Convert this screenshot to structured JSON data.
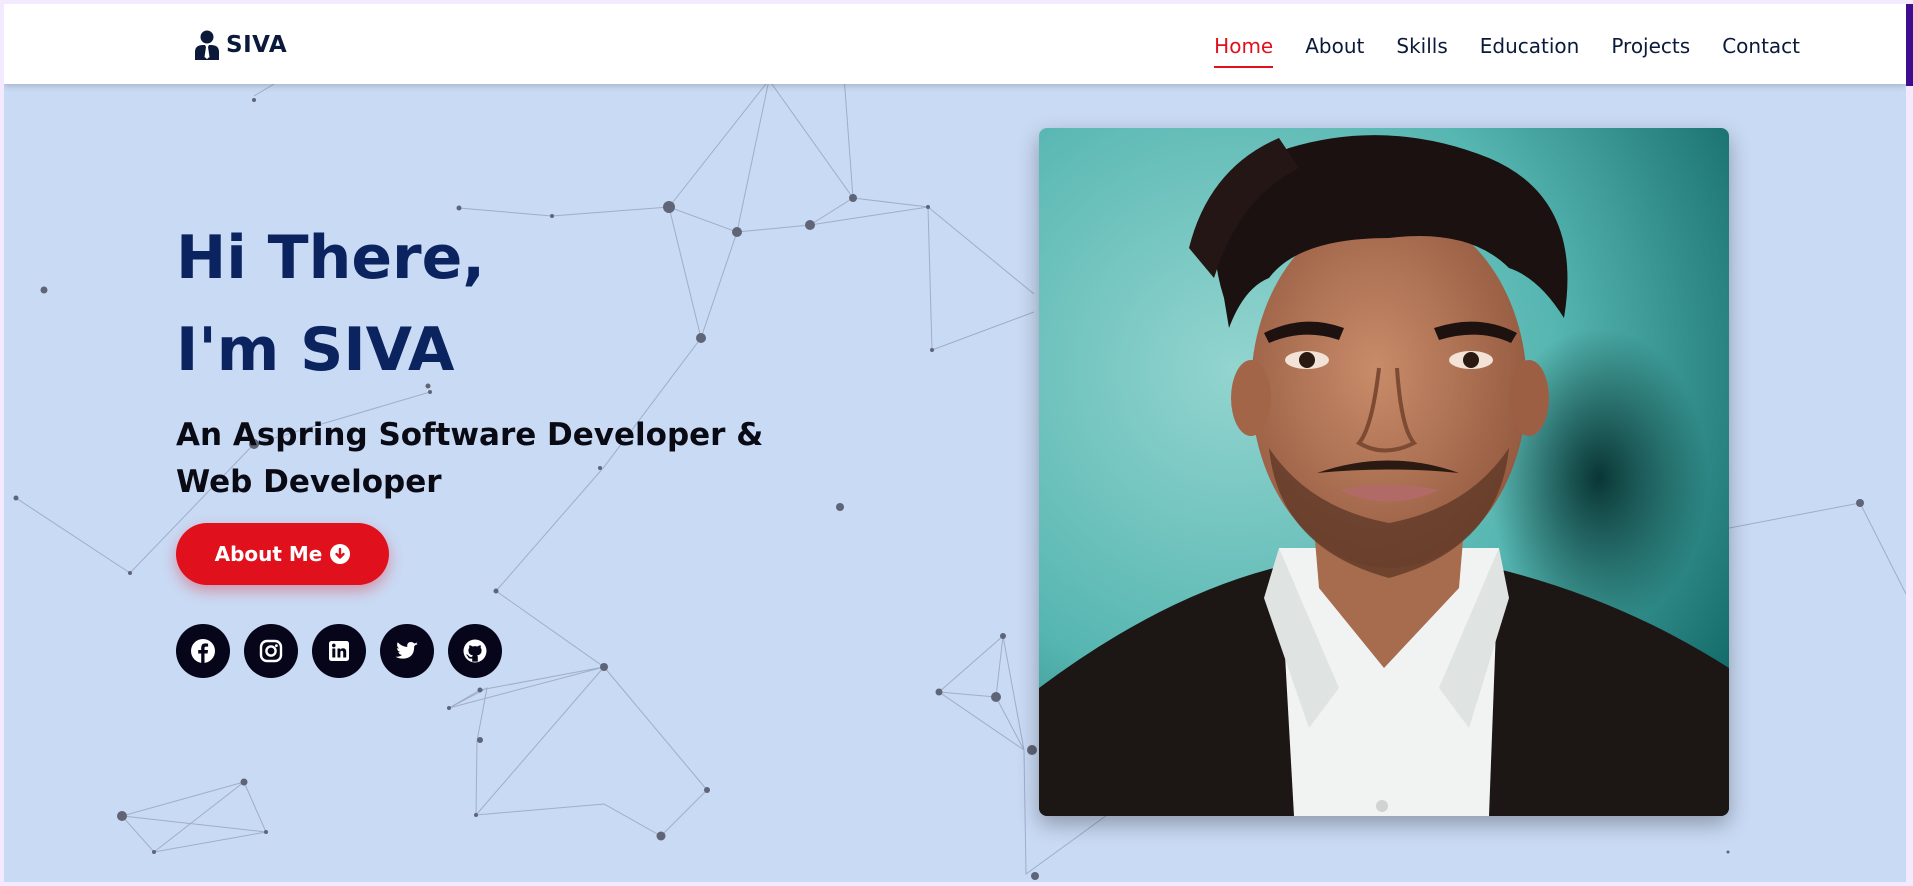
{
  "brand": {
    "name": "SIVA",
    "icon": "user-tie-icon"
  },
  "nav": {
    "items": [
      {
        "label": "Home",
        "active": true
      },
      {
        "label": "About",
        "active": false
      },
      {
        "label": "Skills",
        "active": false
      },
      {
        "label": "Education",
        "active": false
      },
      {
        "label": "Projects",
        "active": false
      },
      {
        "label": "Contact",
        "active": false
      }
    ]
  },
  "hero": {
    "greeting_line1": "Hi There,",
    "greeting_line2": "I'm SIVA",
    "subtitle": "An Aspring Software Developer & Web Developer",
    "button_label": "About Me",
    "button_icon": "arrow-down-circle-icon"
  },
  "socials": [
    {
      "name": "facebook-icon"
    },
    {
      "name": "instagram-icon"
    },
    {
      "name": "linkedin-icon"
    },
    {
      "name": "twitter-icon"
    },
    {
      "name": "github-icon"
    }
  ],
  "portrait": {
    "subject": "profile-photo"
  },
  "colors": {
    "accent": "#e0101c",
    "heading": "#0b2460",
    "background": "#c9daf4",
    "social_bg": "#07051a",
    "side_accent": "#3f0d8f"
  }
}
